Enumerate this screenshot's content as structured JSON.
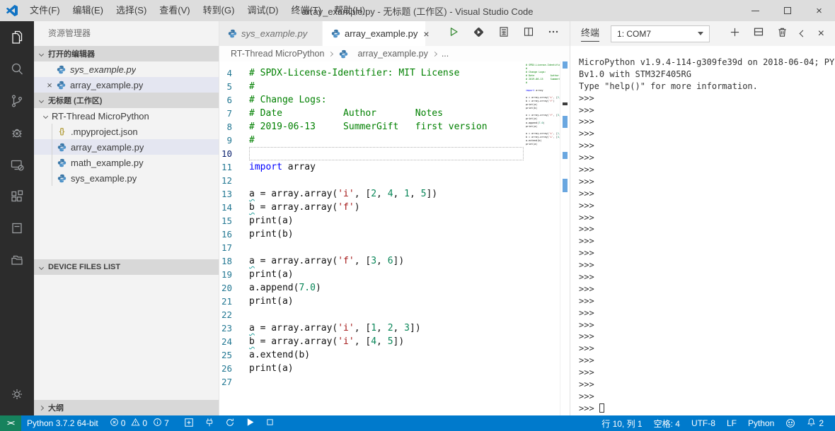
{
  "window": {
    "title": "array_example.py - 无标题 (工作区) - Visual Studio Code"
  },
  "menu": {
    "items": [
      "文件(F)",
      "编辑(E)",
      "选择(S)",
      "查看(V)",
      "转到(G)",
      "调试(D)",
      "终端(T)",
      "帮助(H)"
    ]
  },
  "activity_bar": {
    "icons": [
      "explorer-icon",
      "search-icon",
      "source-control-icon",
      "debug-icon",
      "device-icon",
      "extensions-icon",
      "output-icon",
      "folders-icon",
      "settings-gear-icon"
    ]
  },
  "sidebar": {
    "title": "资源管理器",
    "sections": {
      "open_editors": "打开的编辑器",
      "workspace": "无标题 (工作区)",
      "device_files": "DEVICE FILES LIST",
      "outline": "大纲"
    },
    "open_editor_items": [
      {
        "label": "sys_example.py",
        "icon": "python-icon",
        "preview": true,
        "selected": false,
        "close": false
      },
      {
        "label": "array_example.py",
        "icon": "python-icon",
        "preview": false,
        "selected": true,
        "close": true
      }
    ],
    "tree": {
      "folder": "RT-Thread MicroPython",
      "children": [
        {
          "label": ".mpyproject.json",
          "icon": "json-icon",
          "selected": false
        },
        {
          "label": "array_example.py",
          "icon": "python-icon",
          "selected": true
        },
        {
          "label": "math_example.py",
          "icon": "python-icon",
          "selected": false
        },
        {
          "label": "sys_example.py",
          "icon": "python-icon",
          "selected": false
        }
      ]
    }
  },
  "editor": {
    "tabs": [
      {
        "label": "sys_example.py",
        "active": false,
        "preview": true
      },
      {
        "label": "array_example.py",
        "active": true,
        "preview": false
      }
    ],
    "breadcrumb": [
      "RT-Thread MicroPython",
      "array_example.py",
      "..."
    ],
    "current_line": 10,
    "lines": [
      {
        "n": 4,
        "s": [
          [
            "c",
            "# SPDX-License-Identifier: MIT License"
          ]
        ]
      },
      {
        "n": 5,
        "s": [
          [
            "c",
            "#"
          ]
        ]
      },
      {
        "n": 6,
        "s": [
          [
            "c",
            "# Change Logs:"
          ]
        ]
      },
      {
        "n": 7,
        "s": [
          [
            "c",
            "# Date           Author       Notes"
          ]
        ]
      },
      {
        "n": 8,
        "s": [
          [
            "c",
            "# 2019-06-13     SummerGift   first version"
          ]
        ]
      },
      {
        "n": 9,
        "s": [
          [
            "c",
            "#"
          ]
        ]
      },
      {
        "n": 10,
        "s": []
      },
      {
        "n": 11,
        "s": [
          [
            "k",
            "import"
          ],
          [
            "t",
            " array"
          ]
        ]
      },
      {
        "n": 12,
        "s": []
      },
      {
        "n": 13,
        "s": [
          [
            "v",
            "a"
          ],
          [
            "t",
            " = array.array("
          ],
          [
            "s",
            "'i'"
          ],
          [
            "t",
            ", ["
          ],
          [
            "n",
            "2"
          ],
          [
            "t",
            ", "
          ],
          [
            "n",
            "4"
          ],
          [
            "t",
            ", "
          ],
          [
            "n",
            "1"
          ],
          [
            "t",
            ", "
          ],
          [
            "n",
            "5"
          ],
          [
            "t",
            "])"
          ]
        ]
      },
      {
        "n": 14,
        "s": [
          [
            "v",
            "b"
          ],
          [
            "t",
            " = array.array("
          ],
          [
            "s",
            "'f'"
          ],
          [
            "t",
            ")"
          ]
        ]
      },
      {
        "n": 15,
        "s": [
          [
            "t",
            "print(a)"
          ]
        ]
      },
      {
        "n": 16,
        "s": [
          [
            "t",
            "print(b)"
          ]
        ]
      },
      {
        "n": 17,
        "s": []
      },
      {
        "n": 18,
        "s": [
          [
            "v",
            "a"
          ],
          [
            "t",
            " = array.array("
          ],
          [
            "s",
            "'f'"
          ],
          [
            "t",
            ", ["
          ],
          [
            "n",
            "3"
          ],
          [
            "t",
            ", "
          ],
          [
            "n",
            "6"
          ],
          [
            "t",
            "])"
          ]
        ]
      },
      {
        "n": 19,
        "s": [
          [
            "t",
            "print(a)"
          ]
        ]
      },
      {
        "n": 20,
        "s": [
          [
            "t",
            "a.append("
          ],
          [
            "n",
            "7.0"
          ],
          [
            "t",
            ")"
          ]
        ]
      },
      {
        "n": 21,
        "s": [
          [
            "t",
            "print(a)"
          ]
        ]
      },
      {
        "n": 22,
        "s": []
      },
      {
        "n": 23,
        "s": [
          [
            "v",
            "a"
          ],
          [
            "t",
            " = array.array("
          ],
          [
            "s",
            "'i'"
          ],
          [
            "t",
            ", ["
          ],
          [
            "n",
            "1"
          ],
          [
            "t",
            ", "
          ],
          [
            "n",
            "2"
          ],
          [
            "t",
            ", "
          ],
          [
            "n",
            "3"
          ],
          [
            "t",
            "])"
          ]
        ]
      },
      {
        "n": 24,
        "s": [
          [
            "v",
            "b"
          ],
          [
            "t",
            " = array.array("
          ],
          [
            "s",
            "'i'"
          ],
          [
            "t",
            ", ["
          ],
          [
            "n",
            "4"
          ],
          [
            "t",
            ", "
          ],
          [
            "n",
            "5"
          ],
          [
            "t",
            "])"
          ]
        ]
      },
      {
        "n": 25,
        "s": [
          [
            "t",
            "a.extend(b)"
          ]
        ]
      },
      {
        "n": 26,
        "s": [
          [
            "t",
            "print(a)"
          ]
        ]
      },
      {
        "n": 27,
        "s": []
      }
    ]
  },
  "terminal": {
    "tab_label": "终端",
    "selector": "1: COM7",
    "banner": [
      "MicroPython v1.9.4-114-g309fe39d on 2018-06-04; PY",
      "Bv1.0 with STM32F405RG",
      "Type \"help()\" for more information."
    ],
    "prompt": ">>>",
    "prompt_count": 27
  },
  "status_bar": {
    "python_env": "Python 3.7.2 64-bit",
    "errors": "0",
    "warnings": "0",
    "infos": "7",
    "cursor_position": "行 10, 列 1",
    "indentation": "空格: 4",
    "encoding": "UTF-8",
    "eol": "LF",
    "language": "Python",
    "notification_count": "2"
  },
  "colors": {
    "accent": "#007acc",
    "remote_green": "#16825d",
    "activity_bar_bg": "#2c2c2c",
    "sidebar_bg": "#f3f3f3",
    "selection_bg": "#e4e6f1",
    "comment": "#008000",
    "keyword": "#0000ff",
    "string": "#a31515",
    "number": "#098658",
    "line_number": "#237893",
    "run_green": "#388a34"
  }
}
